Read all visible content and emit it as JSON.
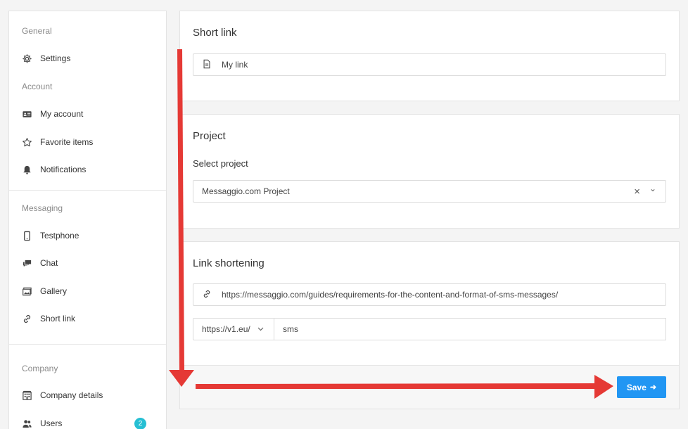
{
  "sidebar": {
    "sections": {
      "general": "General",
      "account": "Account",
      "messaging": "Messaging",
      "company": "Company"
    },
    "items": {
      "settings": "Settings",
      "my_account": "My account",
      "favorite_items": "Favorite items",
      "notifications": "Notifications",
      "testphone": "Testphone",
      "chat": "Chat",
      "gallery": "Gallery",
      "short_link": "Short link",
      "company_details": "Company details",
      "users": "Users"
    },
    "users_badge": "2"
  },
  "short_link_card": {
    "title": "Short link",
    "name_value": "My link"
  },
  "project_card": {
    "title": "Project",
    "select_label": "Select project",
    "selected_value": "Messaggio.com Project",
    "clear_glyph": "×",
    "chevron_glyph": "⌄"
  },
  "shortening_card": {
    "title": "Link shortening",
    "url_value": "https://messaggio.com/guides/requirements-for-the-content-and-format-of-sms-messages/",
    "domain_prefix": "https://v1.eu/",
    "slug_value": "sms",
    "save_label": "Save",
    "save_arrow": "➜"
  },
  "colors": {
    "accent": "#2196f3",
    "badge": "#26bfd3",
    "annotation_arrow": "#e53935"
  }
}
